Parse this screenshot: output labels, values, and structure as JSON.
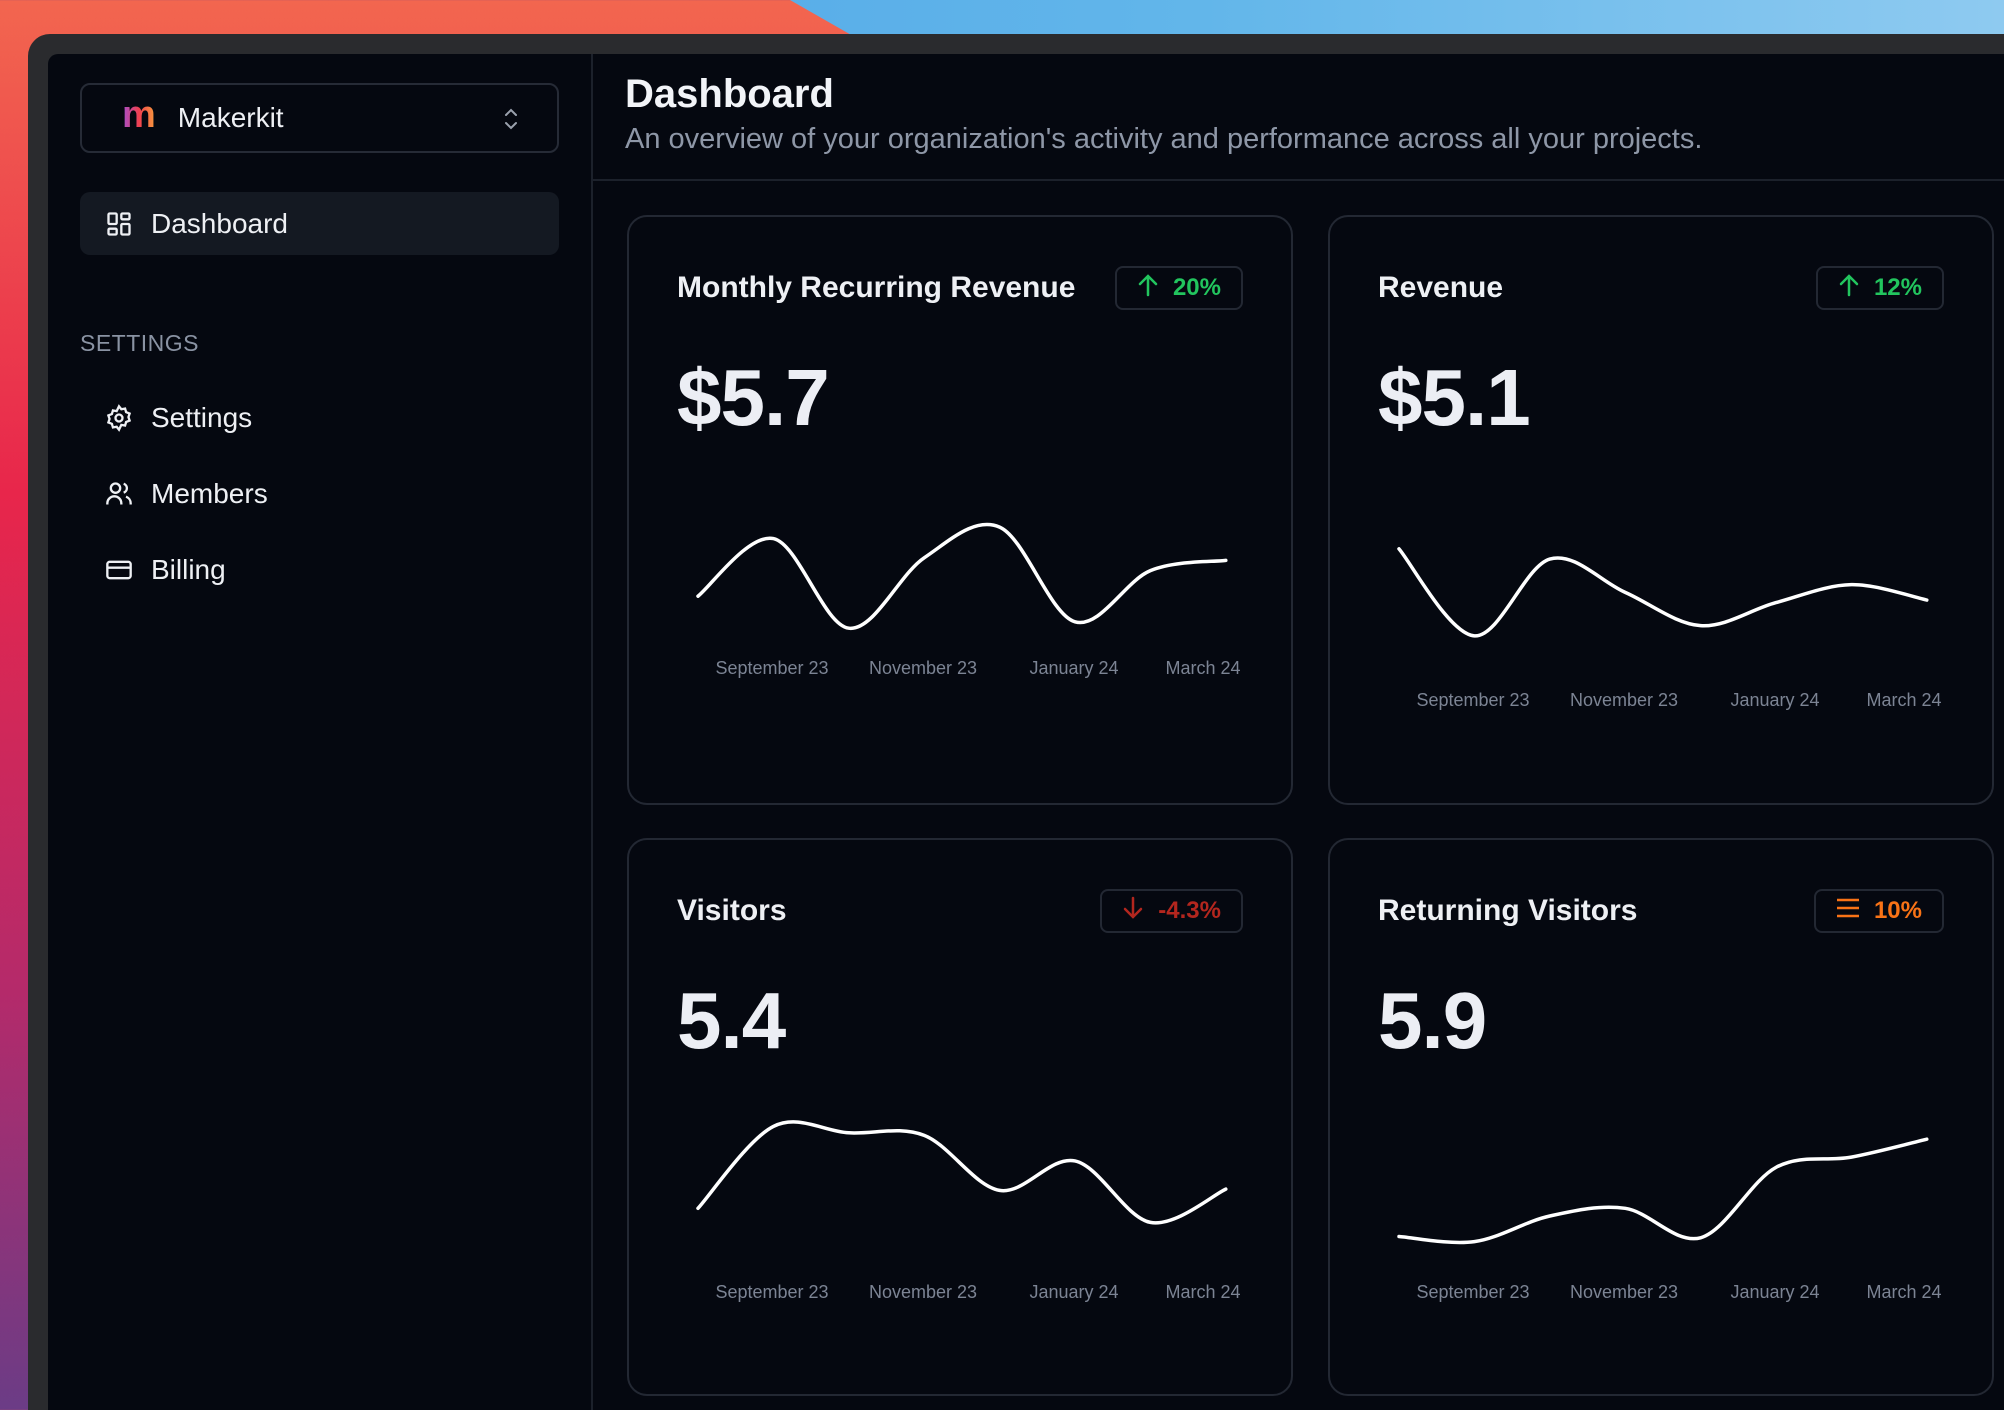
{
  "sidebar": {
    "org_name": "Makerkit",
    "logo_letter": "m",
    "items": [
      {
        "label": "Dashboard",
        "icon": "dashboard-icon",
        "active": true
      }
    ],
    "section_label": "SETTINGS",
    "settings_items": [
      {
        "label": "Settings",
        "icon": "gear-icon"
      },
      {
        "label": "Members",
        "icon": "users-icon"
      },
      {
        "label": "Billing",
        "icon": "credit-card-icon"
      }
    ]
  },
  "header": {
    "title": "Dashboard",
    "subtitle": "An overview of your organization's activity and performance across all your projects."
  },
  "colors": {
    "up": "#22c55e",
    "down": "#b3261e",
    "neutral": "#f97316"
  },
  "cards": [
    {
      "title": "Monthly Recurring Revenue",
      "value": "$5.7",
      "badge": "20%",
      "trend": "up",
      "trend_icon": "arrow-up-icon"
    },
    {
      "title": "Revenue",
      "value": "$5.1",
      "badge": "12%",
      "trend": "up",
      "trend_icon": "arrow-up-icon"
    },
    {
      "title": "Visitors",
      "value": "5.4",
      "badge": "-4.3%",
      "trend": "down",
      "trend_icon": "arrow-down-icon"
    },
    {
      "title": "Returning Visitors",
      "value": "5.9",
      "badge": "10%",
      "trend": "neutral",
      "trend_icon": "menu-lines-icon"
    }
  ],
  "chart_data": [
    {
      "type": "line",
      "ticks": [
        "September 23",
        "November 23",
        "January 24",
        "March 24"
      ],
      "tick_index": [
        1,
        3,
        5,
        7
      ],
      "values": [
        3.5,
        8,
        1,
        6.5,
        8.9,
        1.5,
        5.5,
        6.3
      ],
      "ylim": [
        0,
        10
      ],
      "grid": false
    },
    {
      "type": "line",
      "ticks": [
        "September 23",
        "November 23",
        "January 24",
        "March 24"
      ],
      "tick_index": [
        1,
        3,
        5,
        7
      ],
      "values": [
        7.2,
        0.4,
        6.4,
        3.8,
        1.2,
        3,
        4.4,
        3.2
      ],
      "ylim": [
        0,
        10
      ],
      "grid": false
    },
    {
      "type": "line",
      "ticks": [
        "September 23",
        "November 23",
        "January 24",
        "March 24"
      ],
      "tick_index": [
        1,
        3,
        5,
        7
      ],
      "values": [
        5.6,
        12,
        11.5,
        11.3,
        7,
        9.3,
        4.5,
        7.1
      ],
      "ylim": [
        0,
        10
      ],
      "grid": false
    },
    {
      "type": "line",
      "ticks": [
        "September 23",
        "November 23",
        "January 24",
        "March 24"
      ],
      "tick_index": [
        1,
        3,
        5,
        7
      ],
      "values": [
        3.4,
        3,
        5,
        5.6,
        3.3,
        8.8,
        9.6,
        11
      ],
      "ylim": [
        0,
        10
      ],
      "grid": false
    }
  ]
}
